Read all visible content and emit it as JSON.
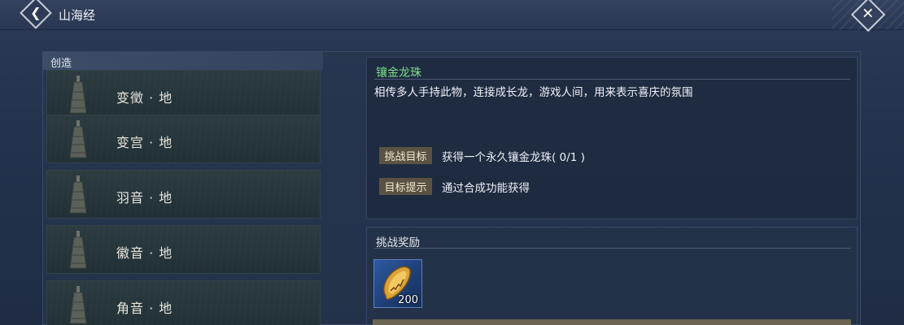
{
  "header": {
    "title": "山海经",
    "back_icon": "back-arrow-icon",
    "close_icon": "close-x-icon"
  },
  "left_panel": {
    "header": "创造",
    "items": [
      {
        "label": "变徵 · 地",
        "icon": "bell-icon"
      },
      {
        "label": "变宫 · 地",
        "icon": "bell-icon"
      },
      {
        "label": "羽音 · 地",
        "icon": "bell-icon"
      },
      {
        "label": "徽音 · 地",
        "icon": "bell-icon"
      },
      {
        "label": "角音 · 地",
        "icon": "bell-icon"
      }
    ]
  },
  "detail": {
    "title": "镶金龙珠",
    "description": "相传多人手持此物，连接成长龙，游戏人间，用来表示喜庆的氛围",
    "challenge_goal_tag": "挑战目标",
    "challenge_goal_text": "获得一个永久镶金龙珠( 0/1 )",
    "goal_hint_tag": "目标提示",
    "goal_hint_text": "通过合成功能获得"
  },
  "reward": {
    "title": "挑战奖励",
    "items": [
      {
        "count": "200",
        "icon": "gold-coin-icon"
      }
    ]
  },
  "colors": {
    "title_green": "#7fdc8a",
    "tag_bg": "#5a5344",
    "reward_slot_blue": "#2d5aa0"
  }
}
